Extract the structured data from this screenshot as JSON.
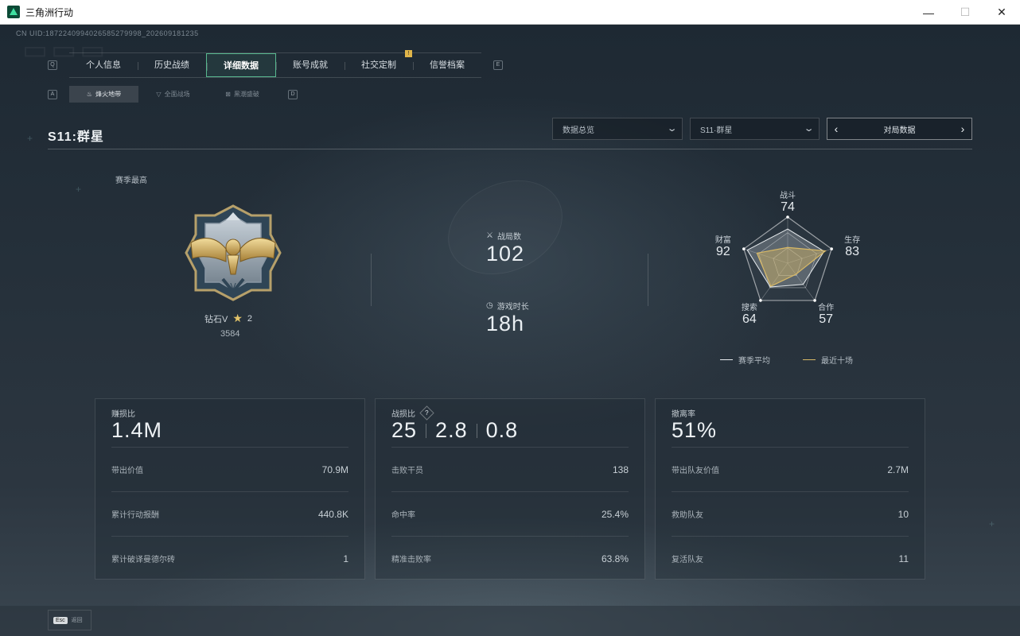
{
  "window": {
    "title": "三角洲行动",
    "minimize_label": "—",
    "maximize_label": "☐",
    "close_label": "✕"
  },
  "uid": "CN UID:1872240994026585279998_202609181235",
  "nav": {
    "left_key": "Q",
    "right_key": "E",
    "tabs": [
      "个人信息",
      "历史战绩",
      "详细数据",
      "账号成就",
      "社交定制",
      "信誉档案"
    ],
    "active_tab": "详细数据",
    "badge_tab": "社交定制",
    "badge_label": "!"
  },
  "sub_nav": {
    "left_key": "A",
    "right_key": "D",
    "tabs": [
      {
        "label": "烽火地带",
        "icon": "flame-icon",
        "glyph": "♨"
      },
      {
        "label": "全面战场",
        "icon": "battlefield-icon",
        "glyph": "▽"
      },
      {
        "label": "黑潮盛破",
        "icon": "tide-icon",
        "glyph": "⊠"
      }
    ],
    "active_tab": "烽火地带"
  },
  "season": {
    "title": "S11:群星",
    "dropdown_view": "数据总览",
    "dropdown_season": "S11·群星",
    "pager_label": "对局数据",
    "pager_prev": "‹",
    "pager_next": "›"
  },
  "rank": {
    "season_best_label": "赛季最高",
    "tier": "钻石V",
    "stars": "2",
    "score": "3584",
    "badge_icon": "eagle-rank-badge"
  },
  "overview": {
    "matches_label": "战局数",
    "matches_value": "102",
    "playtime_label": "游戏时长",
    "playtime_value": "18h"
  },
  "radar": {
    "axes": [
      {
        "label": "战斗",
        "value": "74",
        "season_avg": 0.74,
        "recent_ten": 0.34
      },
      {
        "label": "生存",
        "value": "83",
        "season_avg": 0.83,
        "recent_ten": 0.86
      },
      {
        "label": "合作",
        "value": "57",
        "season_avg": 0.57,
        "recent_ten": 0.3
      },
      {
        "label": "搜索",
        "value": "64",
        "season_avg": 0.64,
        "recent_ten": 0.62
      },
      {
        "label": "财富",
        "value": "92",
        "season_avg": 0.92,
        "recent_ten": 0.7
      }
    ],
    "legend_season": "赛季平均",
    "legend_recent": "最近十场",
    "color_season": "#e8ecef",
    "color_recent": "#d7b866"
  },
  "cards": [
    {
      "title": "赚损比",
      "big": "1.4M",
      "rows": [
        {
          "label": "带出价值",
          "value": "70.9M"
        },
        {
          "label": "累计行动报酬",
          "value": "440.8K"
        },
        {
          "label": "累计破译曼德尔砖",
          "value": "1"
        }
      ]
    },
    {
      "title": "战损比",
      "help": "?",
      "bigs": [
        "25",
        "2.8",
        "0.8"
      ],
      "rows": [
        {
          "label": "击败干员",
          "value": "138"
        },
        {
          "label": "命中率",
          "value": "25.4%"
        },
        {
          "label": "精准击败率",
          "value": "63.8%"
        }
      ]
    },
    {
      "title": "撤离率",
      "big": "51%",
      "rows": [
        {
          "label": "带出队友价值",
          "value": "2.7M"
        },
        {
          "label": "救助队友",
          "value": "10"
        },
        {
          "label": "复活队友",
          "value": "11"
        }
      ]
    }
  ],
  "footer": {
    "esc_key": "Esc",
    "back_label": "返回"
  }
}
